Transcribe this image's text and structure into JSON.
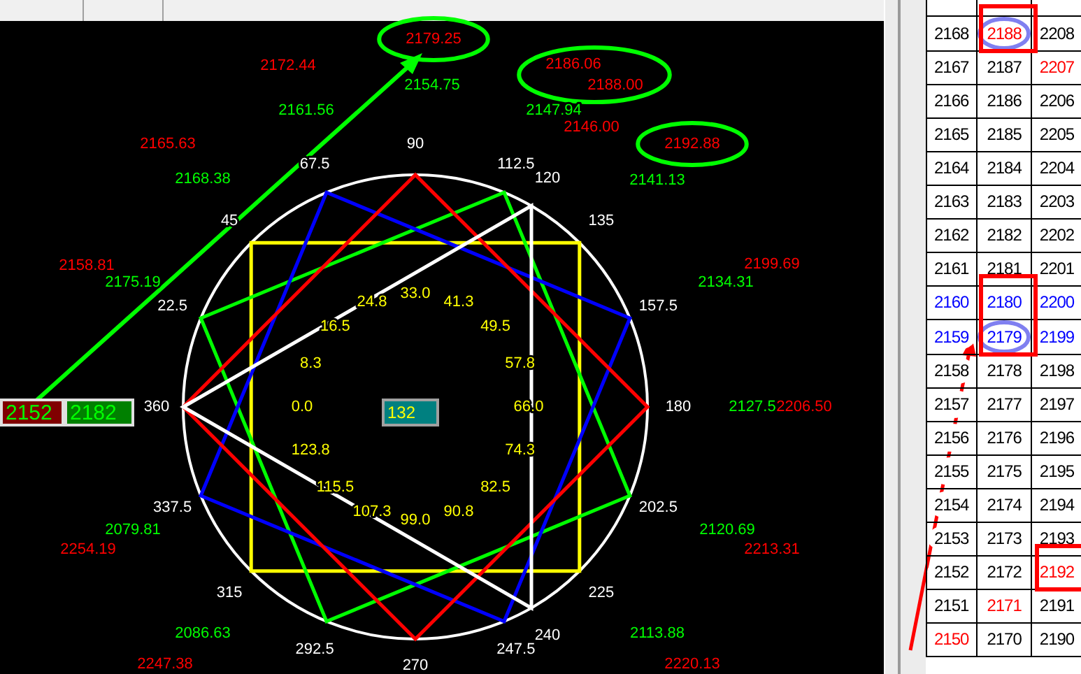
{
  "chart": {
    "angle_labels": [
      "90",
      "67.5",
      "45",
      "22.5",
      "360",
      "337.5",
      "315",
      "292.5",
      "270",
      "247.5",
      "240",
      "225",
      "202.5",
      "180",
      "157.5",
      "135",
      "120",
      "112.5"
    ],
    "inner_labels": [
      "0.0",
      "8.3",
      "16.5",
      "24.8",
      "33.0",
      "41.3",
      "49.5",
      "57.8",
      "66.0",
      "74.3",
      "82.5",
      "90.8",
      "99.0",
      "107.3",
      "115.5",
      "123.8"
    ],
    "price_labels": [
      {
        "text": "2179.25",
        "color": "#ff0000",
        "circled": true
      },
      {
        "text": "2172.44",
        "color": "#ff0000",
        "circled": false
      },
      {
        "text": "2186.06",
        "color": "#ff0000",
        "circled": true
      },
      {
        "text": "2188.00",
        "color": "#ff0000",
        "circled": true
      },
      {
        "text": "2154.75",
        "color": "#00ff00",
        "circled": false
      },
      {
        "text": "2161.56",
        "color": "#00ff00",
        "circled": false
      },
      {
        "text": "2147.94",
        "color": "#00ff00",
        "circled": false
      },
      {
        "text": "2146.00",
        "color": "#ff0000",
        "circled": false
      },
      {
        "text": "2192.88",
        "color": "#ff0000",
        "circled": true
      },
      {
        "text": "2165.63",
        "color": "#ff0000",
        "circled": false
      },
      {
        "text": "2168.38",
        "color": "#00ff00",
        "circled": false
      },
      {
        "text": "2141.13",
        "color": "#00ff00",
        "circled": false
      },
      {
        "text": "2158.81",
        "color": "#ff0000",
        "circled": false
      },
      {
        "text": "2175.19",
        "color": "#00ff00",
        "circled": false
      },
      {
        "text": "2199.69",
        "color": "#ff0000",
        "circled": false
      },
      {
        "text": "2134.31",
        "color": "#00ff00",
        "circled": false
      },
      {
        "text": "2127.5",
        "color": "#00ff00",
        "circled": false
      },
      {
        "text": "2206.50",
        "color": "#ff0000",
        "circled": false
      },
      {
        "text": "2079.81",
        "color": "#00ff00",
        "circled": false
      },
      {
        "text": "2254.19",
        "color": "#ff0000",
        "circled": false
      },
      {
        "text": "2120.69",
        "color": "#00ff00",
        "circled": false
      },
      {
        "text": "2213.31",
        "color": "#ff0000",
        "circled": false
      },
      {
        "text": "2086.63",
        "color": "#00ff00",
        "circled": false
      },
      {
        "text": "2113.88",
        "color": "#00ff00",
        "circled": false
      },
      {
        "text": "2247.38",
        "color": "#ff0000",
        "circled": false
      },
      {
        "text": "2220.13",
        "color": "#ff0000",
        "circled": false
      }
    ],
    "fields": [
      {
        "kind": "low",
        "value": "2152"
      },
      {
        "kind": "high",
        "value": "2182"
      },
      {
        "kind": "count",
        "value": "132"
      }
    ]
  },
  "grid": {
    "rows": [
      {
        "cells": [
          {
            "text": "2168",
            "color": "#000000",
            "highlighted": false,
            "boxed": false
          },
          {
            "text": "2188",
            "color": "#ff0000",
            "highlighted": true,
            "boxed": true
          },
          {
            "text": "2208",
            "color": "#000000",
            "highlighted": false,
            "boxed": false
          }
        ]
      },
      {
        "cells": [
          {
            "text": "2167",
            "color": "#000000",
            "highlighted": false,
            "boxed": false
          },
          {
            "text": "2187",
            "color": "#000000",
            "highlighted": false,
            "boxed": false
          },
          {
            "text": "2207",
            "color": "#ff0000",
            "highlighted": false,
            "boxed": false
          }
        ]
      },
      {
        "cells": [
          {
            "text": "2166",
            "color": "#000000",
            "highlighted": false,
            "boxed": false
          },
          {
            "text": "2186",
            "color": "#000000",
            "highlighted": false,
            "boxed": false
          },
          {
            "text": "2206",
            "color": "#000000",
            "highlighted": false,
            "boxed": false
          }
        ]
      },
      {
        "cells": [
          {
            "text": "2165",
            "color": "#000000",
            "highlighted": false,
            "boxed": false
          },
          {
            "text": "2185",
            "color": "#000000",
            "highlighted": false,
            "boxed": false
          },
          {
            "text": "2205",
            "color": "#000000",
            "highlighted": false,
            "boxed": false
          }
        ]
      },
      {
        "cells": [
          {
            "text": "2164",
            "color": "#000000",
            "highlighted": false,
            "boxed": false
          },
          {
            "text": "2184",
            "color": "#000000",
            "highlighted": false,
            "boxed": false
          },
          {
            "text": "2204",
            "color": "#000000",
            "highlighted": false,
            "boxed": false
          }
        ]
      },
      {
        "cells": [
          {
            "text": "2163",
            "color": "#000000",
            "highlighted": false,
            "boxed": false
          },
          {
            "text": "2183",
            "color": "#000000",
            "highlighted": false,
            "boxed": false
          },
          {
            "text": "2203",
            "color": "#000000",
            "highlighted": false,
            "boxed": false
          }
        ]
      },
      {
        "cells": [
          {
            "text": "2162",
            "color": "#000000",
            "highlighted": false,
            "boxed": false
          },
          {
            "text": "2182",
            "color": "#000000",
            "highlighted": false,
            "boxed": false
          },
          {
            "text": "2202",
            "color": "#000000",
            "highlighted": false,
            "boxed": false
          }
        ]
      },
      {
        "cells": [
          {
            "text": "2161",
            "color": "#000000",
            "highlighted": false,
            "boxed": false
          },
          {
            "text": "2181",
            "color": "#000000",
            "highlighted": false,
            "boxed": false
          },
          {
            "text": "2201",
            "color": "#000000",
            "highlighted": false,
            "boxed": false
          }
        ]
      },
      {
        "cells": [
          {
            "text": "2160",
            "color": "#0000ff",
            "highlighted": false,
            "boxed": false
          },
          {
            "text": "2180",
            "color": "#0000ff",
            "highlighted": false,
            "boxed": true
          },
          {
            "text": "2200",
            "color": "#0000ff",
            "highlighted": false,
            "boxed": false
          }
        ]
      },
      {
        "cells": [
          {
            "text": "2159",
            "color": "#0000ff",
            "highlighted": false,
            "boxed": false
          },
          {
            "text": "2179",
            "color": "#0000ff",
            "highlighted": true,
            "boxed": true
          },
          {
            "text": "2199",
            "color": "#0000ff",
            "highlighted": false,
            "boxed": false
          }
        ]
      },
      {
        "cells": [
          {
            "text": "2158",
            "color": "#000000",
            "highlighted": false,
            "boxed": false
          },
          {
            "text": "2178",
            "color": "#000000",
            "highlighted": false,
            "boxed": false
          },
          {
            "text": "2198",
            "color": "#000000",
            "highlighted": false,
            "boxed": false
          }
        ]
      },
      {
        "cells": [
          {
            "text": "2157",
            "color": "#000000",
            "highlighted": false,
            "boxed": false
          },
          {
            "text": "2177",
            "color": "#000000",
            "highlighted": false,
            "boxed": false
          },
          {
            "text": "2197",
            "color": "#000000",
            "highlighted": false,
            "boxed": false
          }
        ]
      },
      {
        "cells": [
          {
            "text": "2156",
            "color": "#000000",
            "highlighted": false,
            "boxed": false
          },
          {
            "text": "2176",
            "color": "#000000",
            "highlighted": false,
            "boxed": false
          },
          {
            "text": "2196",
            "color": "#000000",
            "highlighted": false,
            "boxed": false
          }
        ]
      },
      {
        "cells": [
          {
            "text": "2155",
            "color": "#000000",
            "highlighted": false,
            "boxed": false
          },
          {
            "text": "2175",
            "color": "#000000",
            "highlighted": false,
            "boxed": false
          },
          {
            "text": "2195",
            "color": "#000000",
            "highlighted": false,
            "boxed": false
          }
        ]
      },
      {
        "cells": [
          {
            "text": "2154",
            "color": "#000000",
            "highlighted": false,
            "boxed": false
          },
          {
            "text": "2174",
            "color": "#000000",
            "highlighted": false,
            "boxed": false
          },
          {
            "text": "2194",
            "color": "#000000",
            "highlighted": false,
            "boxed": false
          }
        ]
      },
      {
        "cells": [
          {
            "text": "2153",
            "color": "#000000",
            "highlighted": false,
            "boxed": false
          },
          {
            "text": "2173",
            "color": "#000000",
            "highlighted": false,
            "boxed": false
          },
          {
            "text": "2193",
            "color": "#000000",
            "highlighted": false,
            "boxed": false
          }
        ]
      },
      {
        "cells": [
          {
            "text": "2152",
            "color": "#000000",
            "highlighted": false,
            "boxed": false
          },
          {
            "text": "2172",
            "color": "#000000",
            "highlighted": false,
            "boxed": false
          },
          {
            "text": "2192",
            "color": "#ff0000",
            "highlighted": false,
            "boxed": true
          }
        ]
      },
      {
        "cells": [
          {
            "text": "2151",
            "color": "#000000",
            "highlighted": false,
            "boxed": false
          },
          {
            "text": "2171",
            "color": "#ff0000",
            "highlighted": false,
            "boxed": false
          },
          {
            "text": "2191",
            "color": "#000000",
            "highlighted": false,
            "boxed": false
          }
        ]
      },
      {
        "cells": [
          {
            "text": "2150",
            "color": "#ff0000",
            "highlighted": false,
            "boxed": false
          },
          {
            "text": "2170",
            "color": "#000000",
            "highlighted": false,
            "boxed": false
          },
          {
            "text": "2190",
            "color": "#000000",
            "highlighted": false,
            "boxed": false
          }
        ]
      }
    ]
  }
}
